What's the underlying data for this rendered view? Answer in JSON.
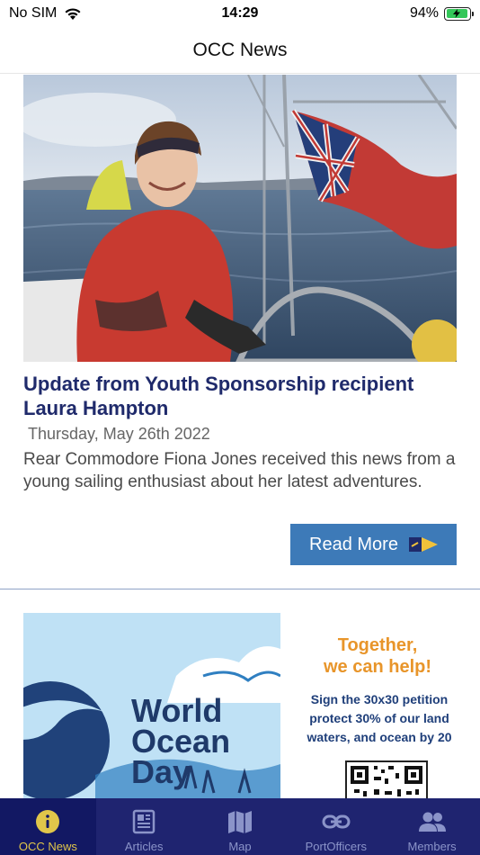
{
  "status_bar": {
    "carrier": "No SIM",
    "time": "14:29",
    "battery_percent": "94%",
    "battery_level": 0.94
  },
  "nav": {
    "title": "OCC News"
  },
  "article": {
    "title": "Update  from Youth Sponsorship recipient Laura Hampton",
    "date": "Thursday, May 26th 2022",
    "summary": "Rear Commodore Fiona Jones received this news from a young sailing enthusiast about her latest adventures.",
    "read_more_label": "Read More"
  },
  "promo": {
    "logo_text_1": "World",
    "logo_text_2": "Ocean",
    "logo_text_3": "Day",
    "heading_line_1": "Together,",
    "heading_line_2": "we can help!",
    "body_line_1": "Sign the 30x30 petition",
    "body_line_2": "protect 30% of our land",
    "body_line_3": "waters, and ocean by 20"
  },
  "tabs": [
    {
      "label": "OCC News",
      "icon": "info-icon",
      "active": true
    },
    {
      "label": "Articles",
      "icon": "newspaper-icon",
      "active": false
    },
    {
      "label": "Map",
      "icon": "map-icon",
      "active": false
    },
    {
      "label": "PortOfficers",
      "icon": "link-icon",
      "active": false
    },
    {
      "label": "Members",
      "icon": "members-icon",
      "active": false
    }
  ],
  "colors": {
    "title": "#1f2a6b",
    "read_more_bg": "#3d7ab8",
    "tab_bar_bg": "#1f2470",
    "tab_active_bg": "#121863",
    "tab_active_fg": "#e0c64a",
    "tab_inactive_fg": "#8b94c9",
    "battery_fill": "#34c759"
  }
}
